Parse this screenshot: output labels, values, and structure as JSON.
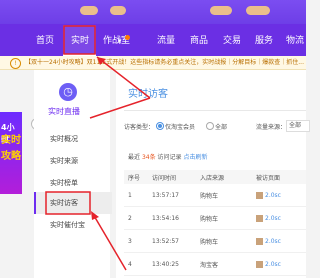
{
  "nav": {
    "items": [
      {
        "label": "首页"
      },
      {
        "label": "实时"
      },
      {
        "label": "作战室"
      },
      {
        "label": "流量"
      },
      {
        "label": "商品"
      },
      {
        "label": "交易"
      },
      {
        "label": "服务"
      },
      {
        "label": "物流"
      }
    ]
  },
  "notice": {
    "text": "【双十一24小时攻略】双11正式开战！这些指标请务必重点关注，实时战报｜分解目标｜爆款查｜抓住..."
  },
  "banner": {
    "line1": "4小时",
    "line2": "实时",
    "line3": "攻略"
  },
  "sidebar": {
    "header": "实时直播",
    "items": [
      {
        "label": "实时概况"
      },
      {
        "label": "实时来源"
      },
      {
        "label": "实时榜单"
      },
      {
        "label": "实时访客"
      },
      {
        "label": "实时催付宝"
      }
    ]
  },
  "main": {
    "title": "实时访客",
    "filter": {
      "visitor_type_label": "访客类型：",
      "option_member": "仅淘宝会员",
      "option_all": "全部",
      "source_label": "流量来源：",
      "source_value": "全部"
    },
    "recent": {
      "prefix": "最近",
      "count": "34条",
      "suffix": "访问记录",
      "link": "点击刷新"
    },
    "table": {
      "headers": [
        "序号",
        "访问时间",
        "入店来源",
        "被访页面"
      ],
      "rows": [
        {
          "no": "1",
          "time": "13:57:17",
          "source": "购物车",
          "page": "2.0sc"
        },
        {
          "no": "2",
          "time": "13:54:16",
          "source": "购物车",
          "page": "2.0sc"
        },
        {
          "no": "3",
          "time": "13:52:57",
          "source": "购物车",
          "page": "2.0sc"
        },
        {
          "no": "4",
          "time": "13:40:25",
          "source": "淘宝客",
          "page": "2.0sc"
        }
      ]
    }
  },
  "colors": {
    "nav_bg": "#6b2fe4",
    "accent": "#6d2cf0",
    "link": "#4a90e2",
    "annotation_arrow": "#e5232b"
  }
}
